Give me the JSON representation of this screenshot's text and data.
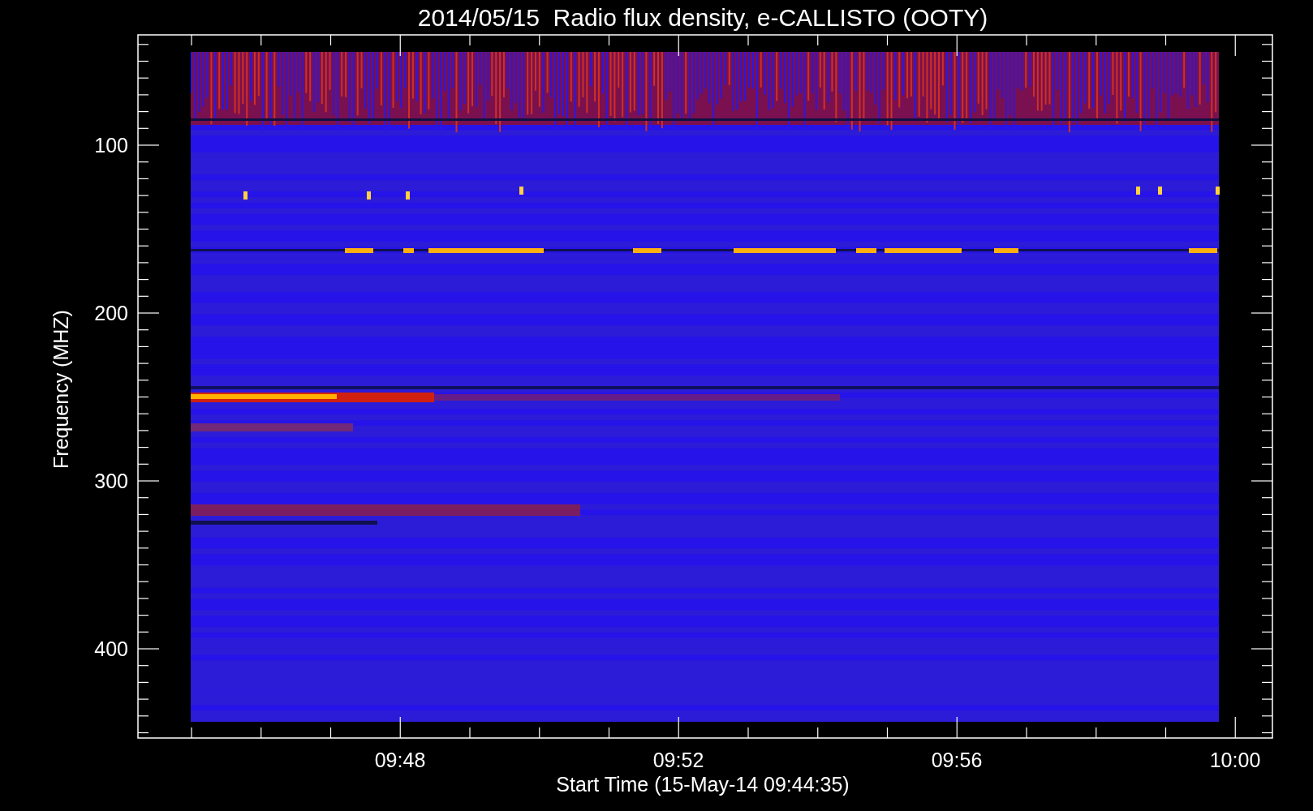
{
  "title": "2014/05/15  Radio flux density, e-CALLISTO (OOTY)",
  "y_axis": {
    "label": "Frequency (MHZ)",
    "ticks": [
      "100",
      "200",
      "300",
      "400"
    ]
  },
  "x_axis": {
    "label": "Start Time (15-May-14 09:44:35)",
    "ticks": [
      "09:48",
      "09:52",
      "09:56",
      "10:00"
    ]
  }
}
